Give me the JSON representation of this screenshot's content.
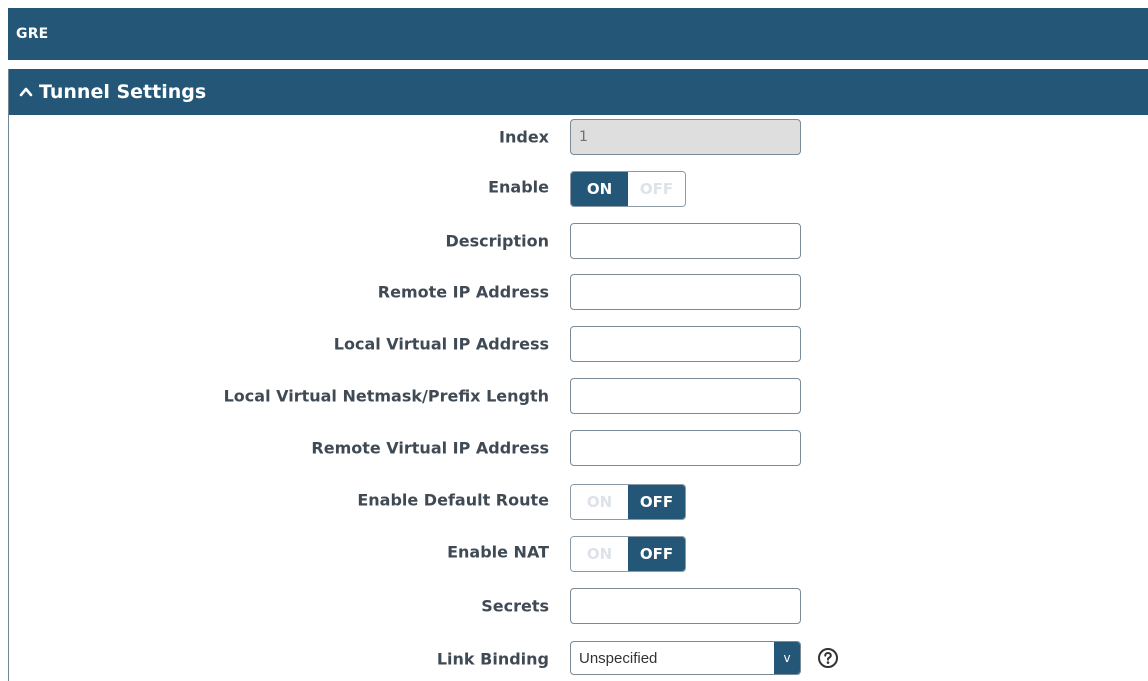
{
  "header": {
    "title": "GRE"
  },
  "section": {
    "title": "Tunnel Settings",
    "expanded": true,
    "chevron_icon": "chevron-up-icon"
  },
  "fields": {
    "index": {
      "label": "Index",
      "value": "1"
    },
    "enable": {
      "label": "Enable",
      "on_label": "ON",
      "off_label": "OFF",
      "state": "on"
    },
    "description": {
      "label": "Description",
      "value": ""
    },
    "remote_ip": {
      "label": "Remote IP Address",
      "value": ""
    },
    "local_virtual_ip": {
      "label": "Local Virtual IP Address",
      "value": ""
    },
    "local_virtual_netmask": {
      "label": "Local Virtual Netmask/Prefix Length",
      "value": ""
    },
    "remote_virtual_ip": {
      "label": "Remote Virtual IP Address",
      "value": ""
    },
    "enable_default_route": {
      "label": "Enable Default Route",
      "on_label": "ON",
      "off_label": "OFF",
      "state": "off"
    },
    "enable_nat": {
      "label": "Enable NAT",
      "on_label": "ON",
      "off_label": "OFF",
      "state": "off"
    },
    "secrets": {
      "label": "Secrets",
      "value": ""
    },
    "link_binding": {
      "label": "Link Binding",
      "selected": "Unspecified",
      "arrow": "v",
      "help_icon": "question-circle-icon"
    }
  },
  "colors": {
    "primary": "#245777",
    "label_text": "#3f4a55",
    "readonly_bg": "#dedede"
  }
}
